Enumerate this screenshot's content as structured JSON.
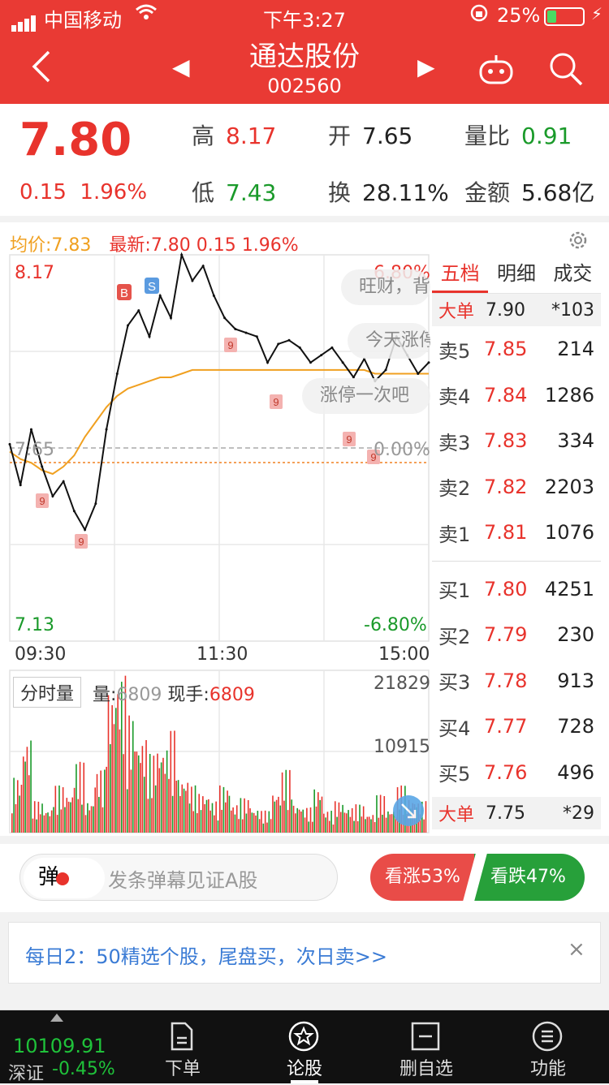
{
  "status": {
    "carrier": "中国移动",
    "time": "下午3:27",
    "battery": "25%"
  },
  "header": {
    "name": "通达股份",
    "code": "002560",
    "prev": "◀",
    "next": "▶"
  },
  "quote": {
    "price": "7.80",
    "change": "0.15",
    "change_pct": "1.96%",
    "high_label": "高",
    "high": "8.17",
    "open_label": "开",
    "open": "7.65",
    "ratio_label": "量比",
    "ratio": "0.91",
    "low_label": "低",
    "low": "7.43",
    "turnover_label": "换",
    "turnover": "28.11%",
    "amount_label": "金额",
    "amount": "5.68亿"
  },
  "legend": {
    "avg": "均价:7.83",
    "last": "最新:7.80 0.15 1.96%"
  },
  "axes": {
    "ymax": "8.17",
    "ymin": "7.13",
    "mid": "7.65",
    "pct_up": "6.80%",
    "pct_zero": "0.00%",
    "pct_down": "-6.80%",
    "t_open": "09:30",
    "t_mid": "11:30",
    "t_close": "15:00",
    "vol_max": "21829",
    "vol_mid": "10915"
  },
  "markers": {
    "buy": "B",
    "sell": "S",
    "nine": "9"
  },
  "bubbles": [
    "旺财，背",
    "今天涨停",
    "涨停一次吧"
  ],
  "volume": {
    "label": "分时量",
    "vol_label": "量:",
    "vol": "6809",
    "hand_label": "现手:",
    "hand": "6809"
  },
  "book": {
    "tabs": [
      "五档",
      "明细",
      "成交"
    ],
    "big_top": {
      "label": "大单",
      "price": "7.90",
      "vol": "*103"
    },
    "asks": [
      {
        "label": "卖5",
        "price": "7.85",
        "vol": "214"
      },
      {
        "label": "卖4",
        "price": "7.84",
        "vol": "1286"
      },
      {
        "label": "卖3",
        "price": "7.83",
        "vol": "334"
      },
      {
        "label": "卖2",
        "price": "7.82",
        "vol": "2203"
      },
      {
        "label": "卖1",
        "price": "7.81",
        "vol": "1076"
      }
    ],
    "bids": [
      {
        "label": "买1",
        "price": "7.80",
        "vol": "4251"
      },
      {
        "label": "买2",
        "price": "7.79",
        "vol": "230"
      },
      {
        "label": "买3",
        "price": "7.78",
        "vol": "913"
      },
      {
        "label": "买4",
        "price": "7.77",
        "vol": "728"
      },
      {
        "label": "买5",
        "price": "7.76",
        "vol": "496"
      }
    ],
    "big_bottom": {
      "label": "大单",
      "price": "7.75",
      "vol": "*29"
    }
  },
  "danmu": {
    "icon": "弹",
    "placeholder": "发条弹幕见证A股",
    "bull": "看涨53%",
    "bear": "看跌47%"
  },
  "promo": {
    "text": "每日2：50精选个股，尾盘买，次日卖>>",
    "close": "×"
  },
  "bottom": {
    "index_value": "10109.91",
    "index_name": "深证",
    "index_pct": "-0.45%",
    "nav": [
      "下单",
      "论股",
      "删自选",
      "功能"
    ]
  },
  "chart_data": {
    "type": "line",
    "title": "",
    "xlabel": "",
    "ylabel": "",
    "x_ticks": [
      "09:30",
      "11:30",
      "15:00"
    ],
    "ylim": [
      7.13,
      8.17
    ],
    "series": [
      {
        "name": "",
        "values": [
          7.66,
          7.55,
          7.7,
          7.6,
          7.52,
          7.56,
          7.48,
          7.43,
          7.5,
          7.7,
          7.85,
          7.98,
          8.02,
          7.95,
          8.06,
          8.0,
          8.17,
          8.1,
          8.14,
          8.06,
          8.0,
          7.97,
          7.96,
          7.95,
          7.88,
          7.93,
          7.94,
          7.92,
          7.88,
          7.9,
          7.92,
          7.88,
          7.84,
          7.89,
          7.83,
          7.86,
          7.95,
          7.9,
          7.85,
          7.88
        ]
      },
      {
        "name": "",
        "values": [
          7.64,
          7.62,
          7.61,
          7.59,
          7.58,
          7.6,
          7.63,
          7.68,
          7.72,
          7.76,
          7.79,
          7.81,
          7.82,
          7.83,
          7.84,
          7.84,
          7.85,
          7.86,
          7.86,
          7.86,
          7.86,
          7.86,
          7.86,
          7.86,
          7.86,
          7.86,
          7.86,
          7.86,
          7.86,
          7.86,
          7.86,
          7.86,
          7.86,
          7.86,
          7.85,
          7.85,
          7.85,
          7.85,
          7.85,
          7.85
        ]
      }
    ]
  }
}
